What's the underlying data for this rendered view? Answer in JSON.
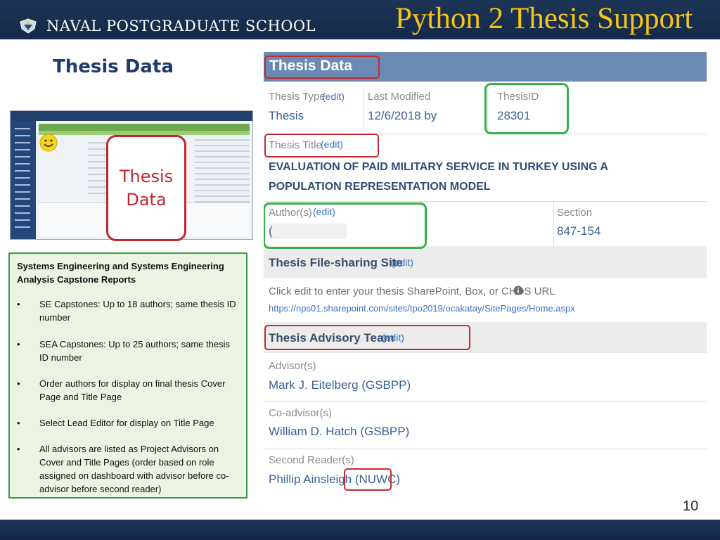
{
  "header": {
    "school_name": "NAVAL POSTGRADUATE SCHOOL",
    "slide_title": "Python 2 Thesis Support"
  },
  "section_heading": "Thesis Data",
  "callout": {
    "line1": "Thesis",
    "line2": "Data"
  },
  "notes": {
    "title": "Systems Engineering and Systems Engineering Analysis Capstone Reports",
    "bullet_glyph": "•",
    "items": [
      "SE Capstones: Up to 18 authors; same thesis ID number",
      "SEA Capstones: Up to 25 authors; same thesis ID number",
      "Order authors for display on final thesis Cover Page and Title Page",
      "Select Lead Editor for display on Title Page",
      "All advisors are listed as Project Advisors on Cover and Title Pages (order based on role assigned on dashboard with advisor before co-advisor before second reader)"
    ]
  },
  "screenshot": {
    "header": "Thesis Data",
    "edit_label": "(edit)",
    "thesis_type": {
      "label": "Thesis Type",
      "value": "Thesis"
    },
    "last_modified": {
      "label": "Last Modified",
      "value": "12/6/2018 by"
    },
    "thesis_id": {
      "label": "ThesisID",
      "value": "28301"
    },
    "thesis_title": {
      "label": "Thesis Title",
      "value": "EVALUATION OF PAID MILITARY SERVICE IN TURKEY USING A POPULATION REPRESENTATION MODEL"
    },
    "authors": {
      "label": "Author(s)",
      "value": "("
    },
    "section": {
      "label": "Section",
      "value": "847-154"
    },
    "file_sharing": {
      "title": "Thesis File-sharing Site",
      "hint": "Click edit to enter your thesis SharePoint, Box, or CHDS URL",
      "info_icon": "i",
      "url": "https://nps01.sharepoint.com/sites/tpo2019/ocakatay/SitePages/Home.aspx"
    },
    "advisory_team": {
      "title": "Thesis Advisory Team"
    },
    "advisor": {
      "label": "Advisor(s)",
      "value": "Mark J. Eitelberg (GSBPP)"
    },
    "co_advisor": {
      "label": "Co-advisor(s)",
      "value": "William D. Hatch (GSBPP)"
    },
    "second_reader": {
      "label": "Second Reader(s)",
      "value": "Phillip Ainsleigh (NUWC)"
    }
  },
  "page_number": "10",
  "colors": {
    "header_bg": "#1d3556",
    "title_gold": "#f5c518",
    "heading_blue": "#1f3b6b",
    "highlight_red": "#c52b30",
    "highlight_green": "#36b049",
    "notes_bg": "#ebf3e3",
    "panel_header": "#6a8ab3",
    "link_blue": "#3b72c2"
  }
}
